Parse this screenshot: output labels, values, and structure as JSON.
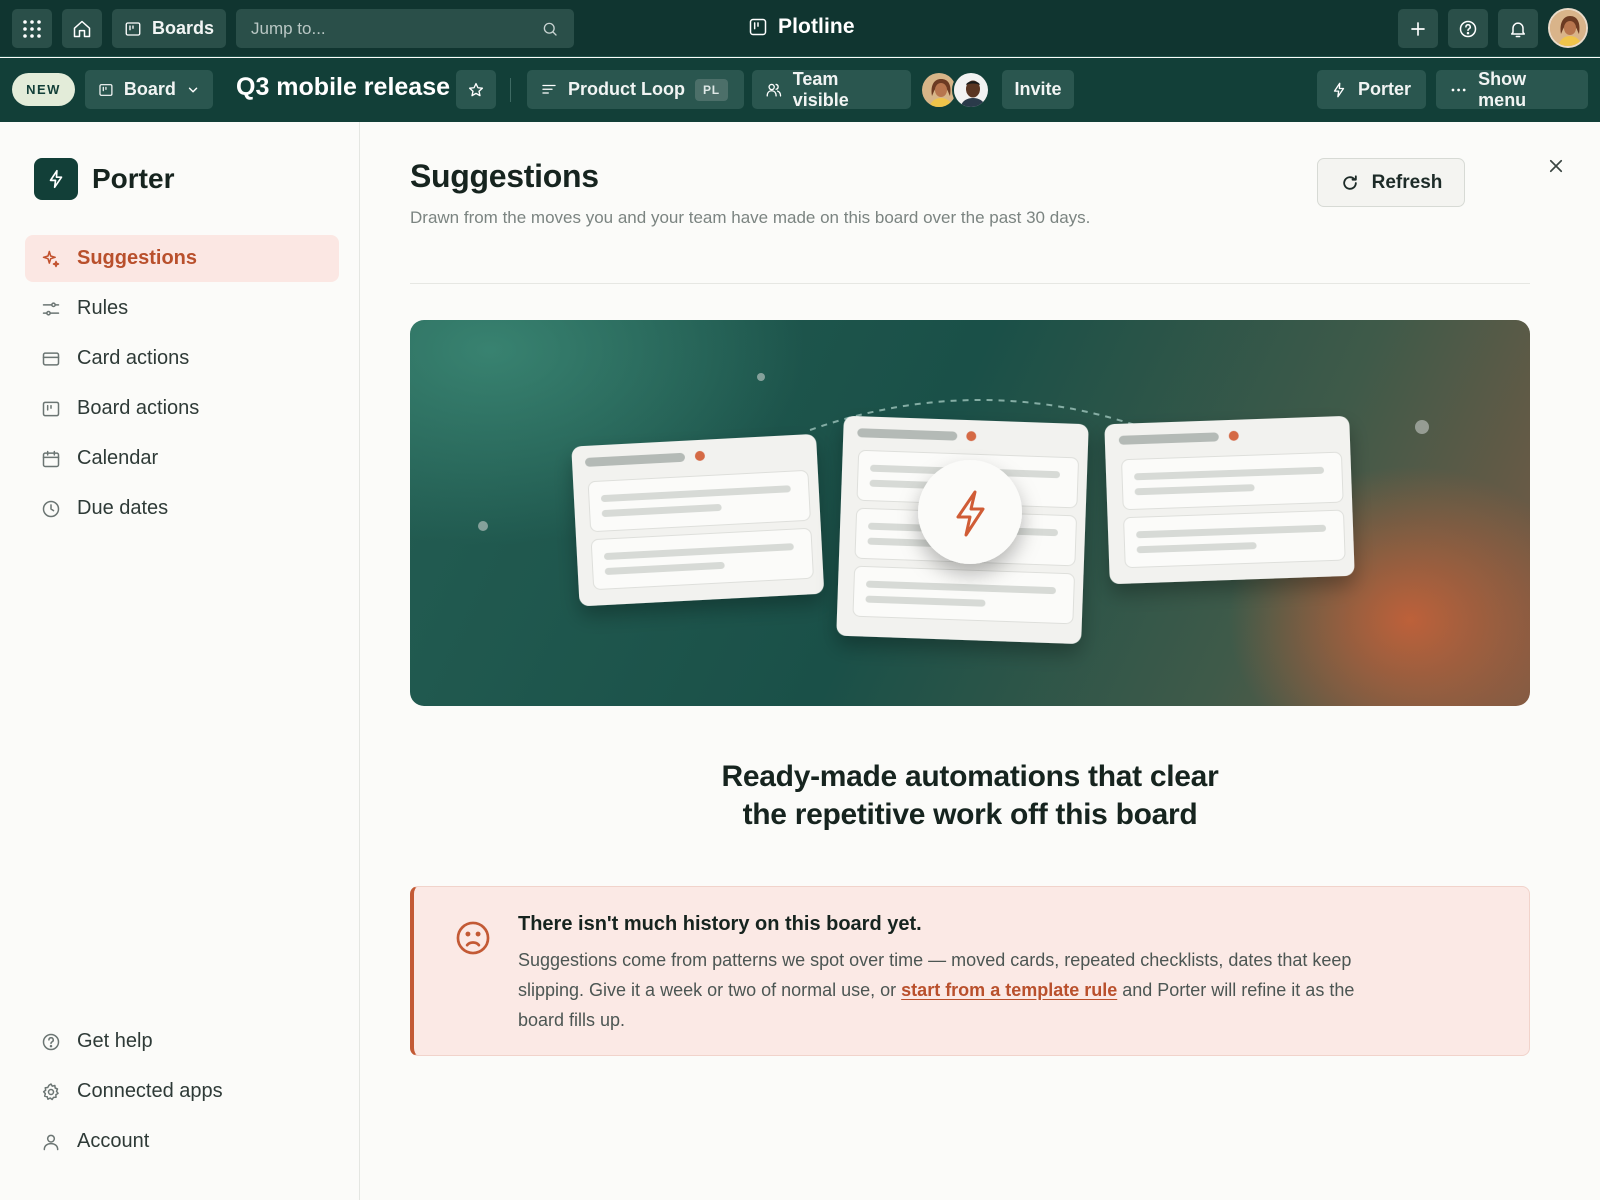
{
  "topbar": {
    "boards_label": "Boards",
    "search_placeholder": "Jump to...",
    "app_name": "Plotline"
  },
  "boardbar": {
    "new_badge": "NEW",
    "view_label": "Board",
    "board_title": "Q3 mobile release",
    "workspace_name": "Product Loop",
    "workspace_badge": "PL",
    "visibility_label": "Team visible",
    "invite_label": "Invite",
    "porter_label": "Porter",
    "show_menu_label": "Show menu"
  },
  "sidebar": {
    "brand": "Porter",
    "items": [
      {
        "label": "Suggestions",
        "icon": "sparkle-icon",
        "active": true
      },
      {
        "label": "Rules",
        "icon": "sliders-icon"
      },
      {
        "label": "Card actions",
        "icon": "card-icon"
      },
      {
        "label": "Board actions",
        "icon": "board-icon"
      },
      {
        "label": "Calendar",
        "icon": "calendar-icon"
      },
      {
        "label": "Due dates",
        "icon": "clock-icon"
      }
    ],
    "footer": [
      {
        "label": "Get help",
        "icon": "help-icon"
      },
      {
        "label": "Connected apps",
        "icon": "gear-icon"
      },
      {
        "label": "Account",
        "icon": "person-icon"
      }
    ]
  },
  "main": {
    "title": "Suggestions",
    "subtitle": "Drawn from the moves you and your team have made on this board over the past 30 days.",
    "refresh_label": "Refresh",
    "tagline_line1": "Ready-made automations that clear",
    "tagline_line2": "the repetitive work off this board",
    "alert": {
      "title": "There isn't much history on this board yet.",
      "body_before": "Suggestions come from patterns we spot over time — moved cards, repeated checklists, dates that keep slipping. Give it a week or two of normal use, or ",
      "link": "start from a template rule",
      "body_after": " and Porter will refine it as the board fills up."
    }
  },
  "colors": {
    "topbar_bg": "#103530",
    "accent": "#c35a35",
    "active_nav_bg": "#fbe7e3"
  }
}
